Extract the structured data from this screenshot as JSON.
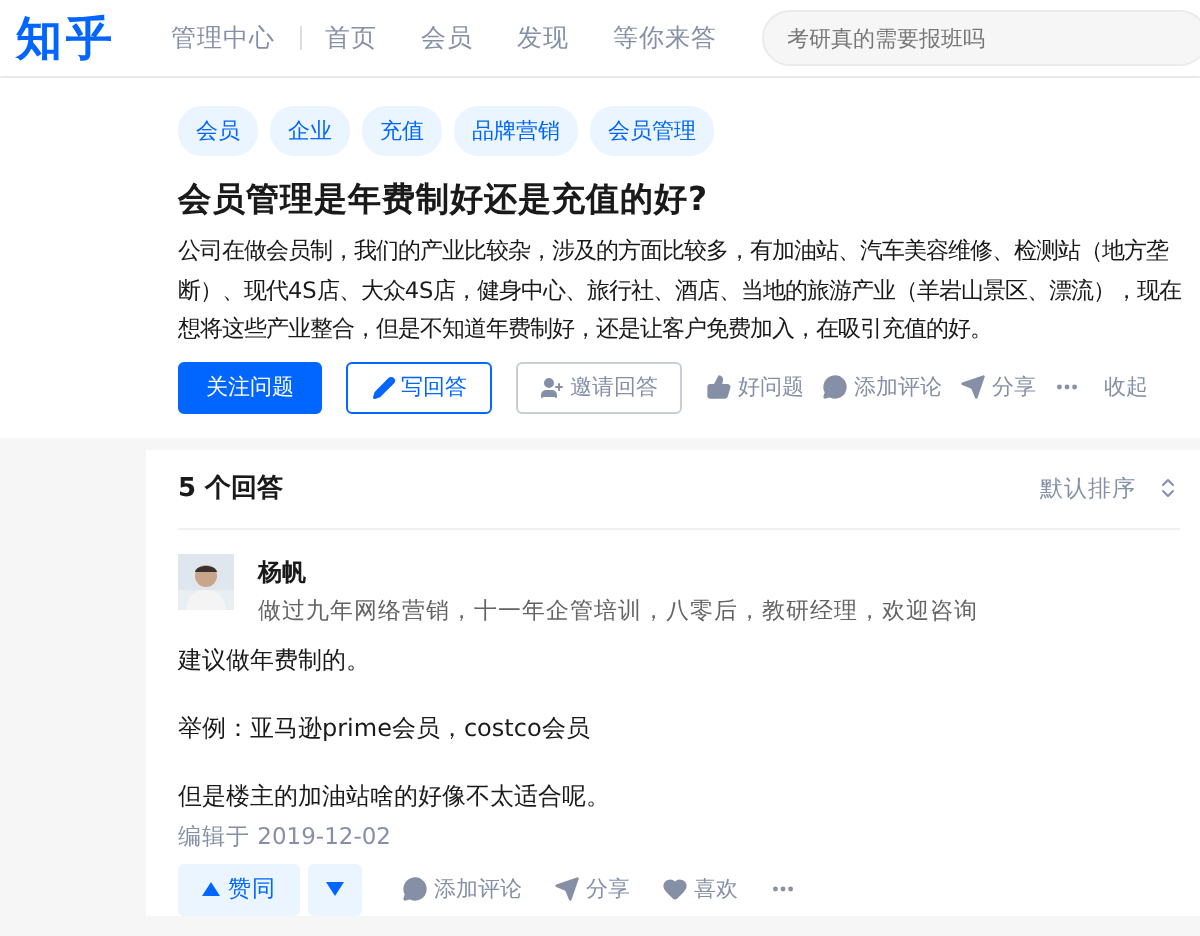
{
  "header": {
    "logo": "知乎",
    "manage_center": "管理中心",
    "nav": [
      "首页",
      "会员",
      "发现",
      "等你来答"
    ],
    "search": {
      "placeholder": "考研真的需要报班吗"
    }
  },
  "question": {
    "tags": [
      "会员",
      "企业",
      "充值",
      "品牌营销",
      "会员管理"
    ],
    "title": "会员管理是年费制好还是充值的好?",
    "description": "公司在做会员制，我们的产业比较杂，涉及的方面比较多，有加油站、汽车美容维修、检测站（地方垄断）、现代4S店、大众4S店，健身中心、旅行社、酒店、当地的旅游产业（羊岩山景区、漂流），现在想将这些产业整合，但是不知道年费制好，还是让客户免费加入，在吸引充值的好。",
    "buttons": [
      {
        "kind": "follow",
        "label": "关注问题"
      },
      {
        "kind": "write",
        "label": "写回答"
      },
      {
        "kind": "invite",
        "label": "邀请回答"
      }
    ],
    "actions": [
      {
        "kind": "like",
        "label": "好问题"
      },
      {
        "kind": "comment",
        "label": "添加评论"
      },
      {
        "kind": "share",
        "label": "分享"
      },
      {
        "kind": "more"
      },
      {
        "kind": "text",
        "label": "收起"
      }
    ]
  },
  "answers": {
    "count": "5 个回答",
    "sort": "默认排序",
    "answer": {
      "author": "杨帆",
      "bio": "做过九年网络营销，十一年企管培训，八零后，教研经理，欢迎咨询",
      "paragraphs": [
        "建议做年费制的。",
        "举例：亚马逊prime会员，costco会员",
        "但是楼主的加油站啥的好像不太适合呢。"
      ],
      "edited": "编辑于 2019-12-02",
      "vote": "赞同",
      "actions": [
        {
          "kind": "comment",
          "label": "添加评论"
        },
        {
          "kind": "share",
          "label": "分享"
        },
        {
          "kind": "heart",
          "label": "喜欢"
        },
        {
          "kind": "more"
        }
      ]
    }
  }
}
